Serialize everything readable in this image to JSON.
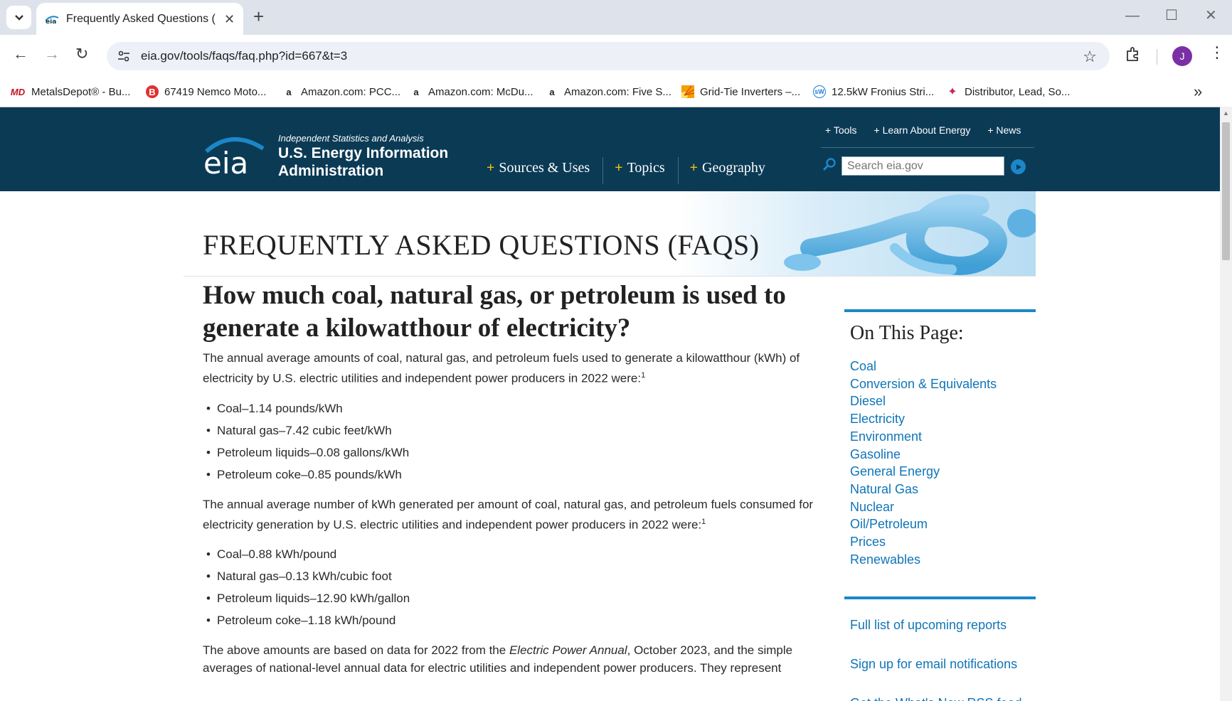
{
  "browser": {
    "tab_title": "Frequently Asked Questions (FA",
    "url": "eia.gov/tools/faqs/faq.php?id=667&t=3",
    "avatar_letter": "J",
    "bookmarks": [
      {
        "label": "MetalsDepot® - Bu...",
        "icon": "MD",
        "color": "#c1121f"
      },
      {
        "label": "67419 Nemco Moto...",
        "icon": "B",
        "color": "#e03131"
      },
      {
        "label": "Amazon.com: PCC...",
        "icon": "a",
        "color": "#111111"
      },
      {
        "label": "Amazon.com: McDu...",
        "icon": "a",
        "color": "#111111"
      },
      {
        "label": "Amazon.com: Five S...",
        "icon": "a",
        "color": "#111111"
      },
      {
        "label": "Grid-Tie Inverters –...",
        "icon": "sun",
        "color": "#f59f00"
      },
      {
        "label": "12.5kW Fronius Stri...",
        "icon": "sW",
        "color": "#1c7ed6"
      },
      {
        "label": "Distributor, Lead, So...",
        "icon": "star",
        "color": "#c2255c"
      }
    ]
  },
  "header": {
    "logo_text": "eia",
    "tagline": "Independent Statistics and Analysis",
    "agency_name": "U.S. Energy Information Administration",
    "main_nav": [
      "Sources & Uses",
      "Topics",
      "Geography"
    ],
    "util_nav": [
      "+ Tools",
      "+ Learn About Energy",
      "+ News"
    ],
    "search_placeholder": "Search eia.gov"
  },
  "banner": {
    "title": "FREQUENTLY ASKED QUESTIONS (FAQS)"
  },
  "article": {
    "question": "How much coal, natural gas, or petroleum is used to generate a kilowatthour of electricity?",
    "intro1": "The annual average amounts of coal, natural gas, and petroleum fuels used to generate a kilowatthour (kWh) of electricity by U.S. electric utilities and independent power producers in 2022 were:",
    "list1": [
      "Coal–1.14 pounds/kWh",
      "Natural gas–7.42 cubic feet/kWh",
      "Petroleum liquids–0.08 gallons/kWh",
      "Petroleum coke–0.85 pounds/kWh"
    ],
    "intro2": "The annual average number of kWh generated per amount of coal, natural gas, and petroleum fuels consumed for electricity generation by U.S. electric utilities and independent power producers in 2022 were:",
    "list2": [
      "Coal–0.88 kWh/pound",
      "Natural gas–0.13 kWh/cubic foot",
      "Petroleum liquids–12.90 kWh/gallon",
      "Petroleum coke–1.18 kWh/pound"
    ],
    "footnote_ref": "1",
    "closing_pre": "The above amounts are based on data for 2022 from the ",
    "closing_italic": "Electric Power Annual",
    "closing_post": ", October 2023, and the simple averages of national-level annual data for electric utilities and independent power producers. They represent"
  },
  "sidebar": {
    "heading": "On This Page:",
    "links": [
      "Coal",
      "Conversion & Equivalents",
      "Diesel",
      "Electricity",
      "Environment",
      "Gasoline",
      "General Energy",
      "Natural Gas",
      "Nuclear",
      "Oil/Petroleum",
      "Prices",
      "Renewables"
    ],
    "extra_links": [
      "Full list of upcoming reports",
      "Sign up for email notifications",
      "Get the What's New RSS feed"
    ]
  }
}
